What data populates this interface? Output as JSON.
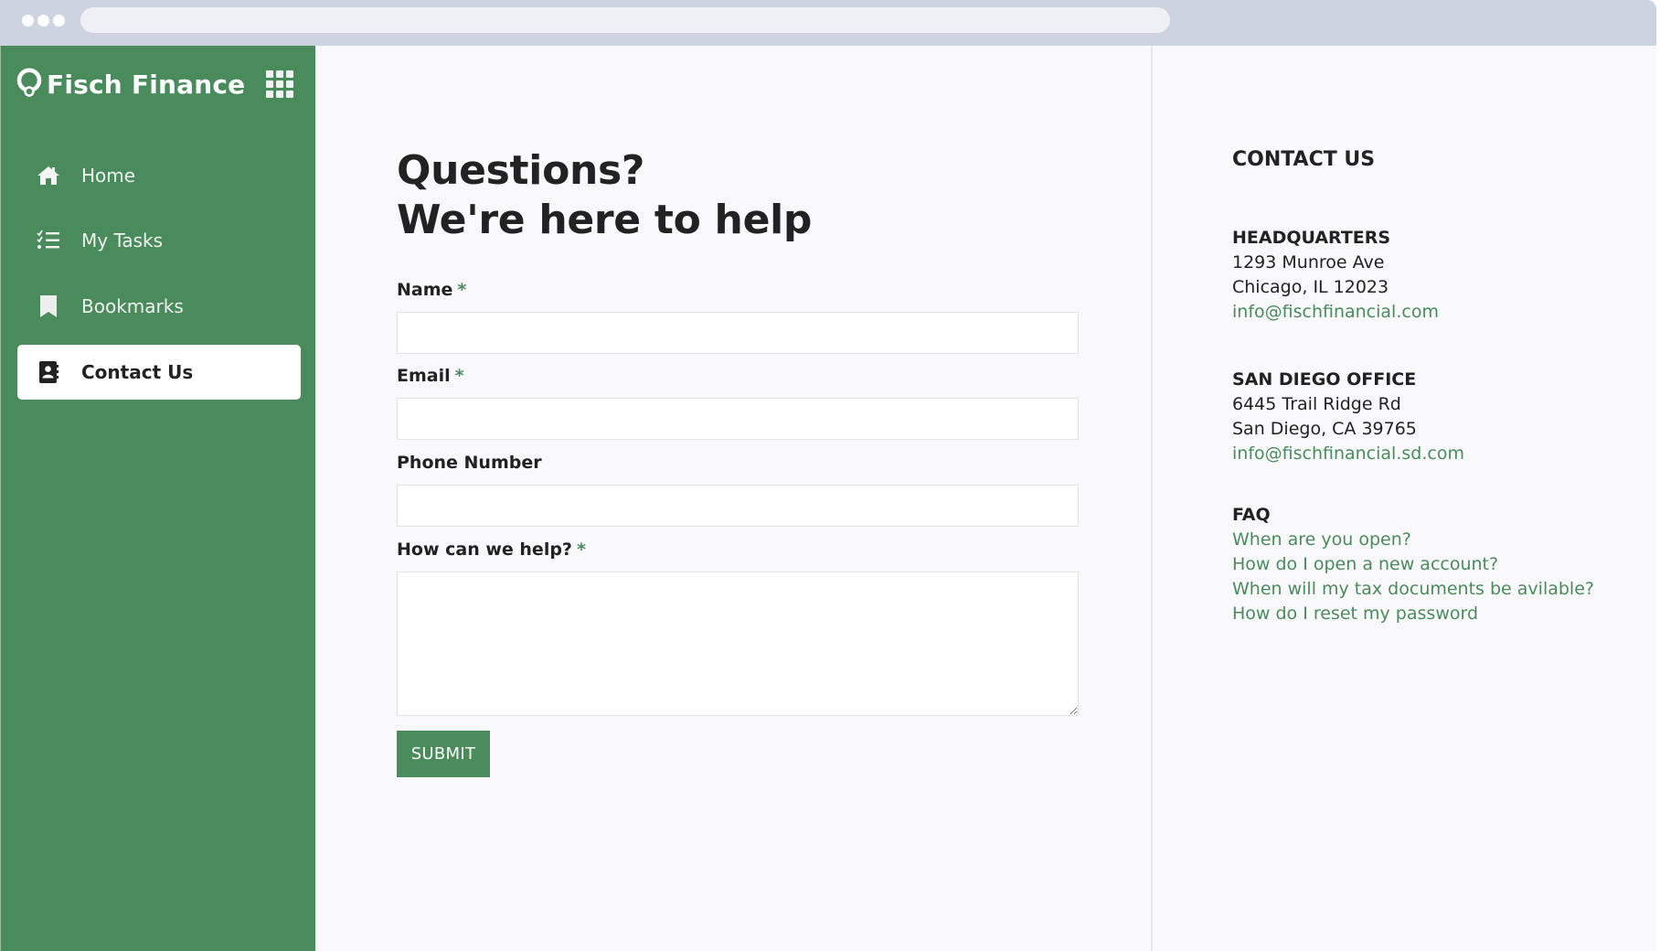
{
  "browser": {
    "window_dots": 3
  },
  "brand": {
    "name": "Fisch Finance",
    "accent_color": "#4a8b5c",
    "logo_icon": "ring-logo-icon",
    "apps_icon": "grid-icon"
  },
  "sidebar": {
    "items": [
      {
        "label": "Home",
        "icon": "home-icon",
        "active": false
      },
      {
        "label": "My Tasks",
        "icon": "task-list-icon",
        "active": false
      },
      {
        "label": "Bookmarks",
        "icon": "bookmark-icon",
        "active": false
      },
      {
        "label": "Contact Us",
        "icon": "address-book-icon",
        "active": true
      }
    ]
  },
  "form": {
    "heading_line1": "Questions?",
    "heading_line2": "We're here to help",
    "required_marker": "*",
    "fields": {
      "name": {
        "label": "Name",
        "required": true,
        "value": "",
        "placeholder": ""
      },
      "email": {
        "label": "Email",
        "required": true,
        "value": "",
        "placeholder": ""
      },
      "phone": {
        "label": "Phone Number",
        "required": false,
        "value": "",
        "placeholder": ""
      },
      "help": {
        "label": "How can we help?",
        "required": true,
        "value": "",
        "placeholder": ""
      }
    },
    "submit_label": "SUBMIT"
  },
  "contact": {
    "title": "CONTACT US",
    "headquarters": {
      "title": "HEADQUARTERS",
      "address1": "1293 Munroe Ave",
      "address2": "Chicago, IL 12023",
      "email": "info@fischfinancial.com"
    },
    "san_diego": {
      "title": "SAN DIEGO OFFICE",
      "address1": "6445 Trail Ridge Rd",
      "address2": "San Diego, CA 39765",
      "email": "info@fischfinancial.sd.com"
    },
    "faq": {
      "title": "FAQ",
      "items": [
        "When are you open?",
        "How do I open a new account?",
        "When will my tax documents be avilable?",
        "How do I reset my password"
      ]
    }
  }
}
